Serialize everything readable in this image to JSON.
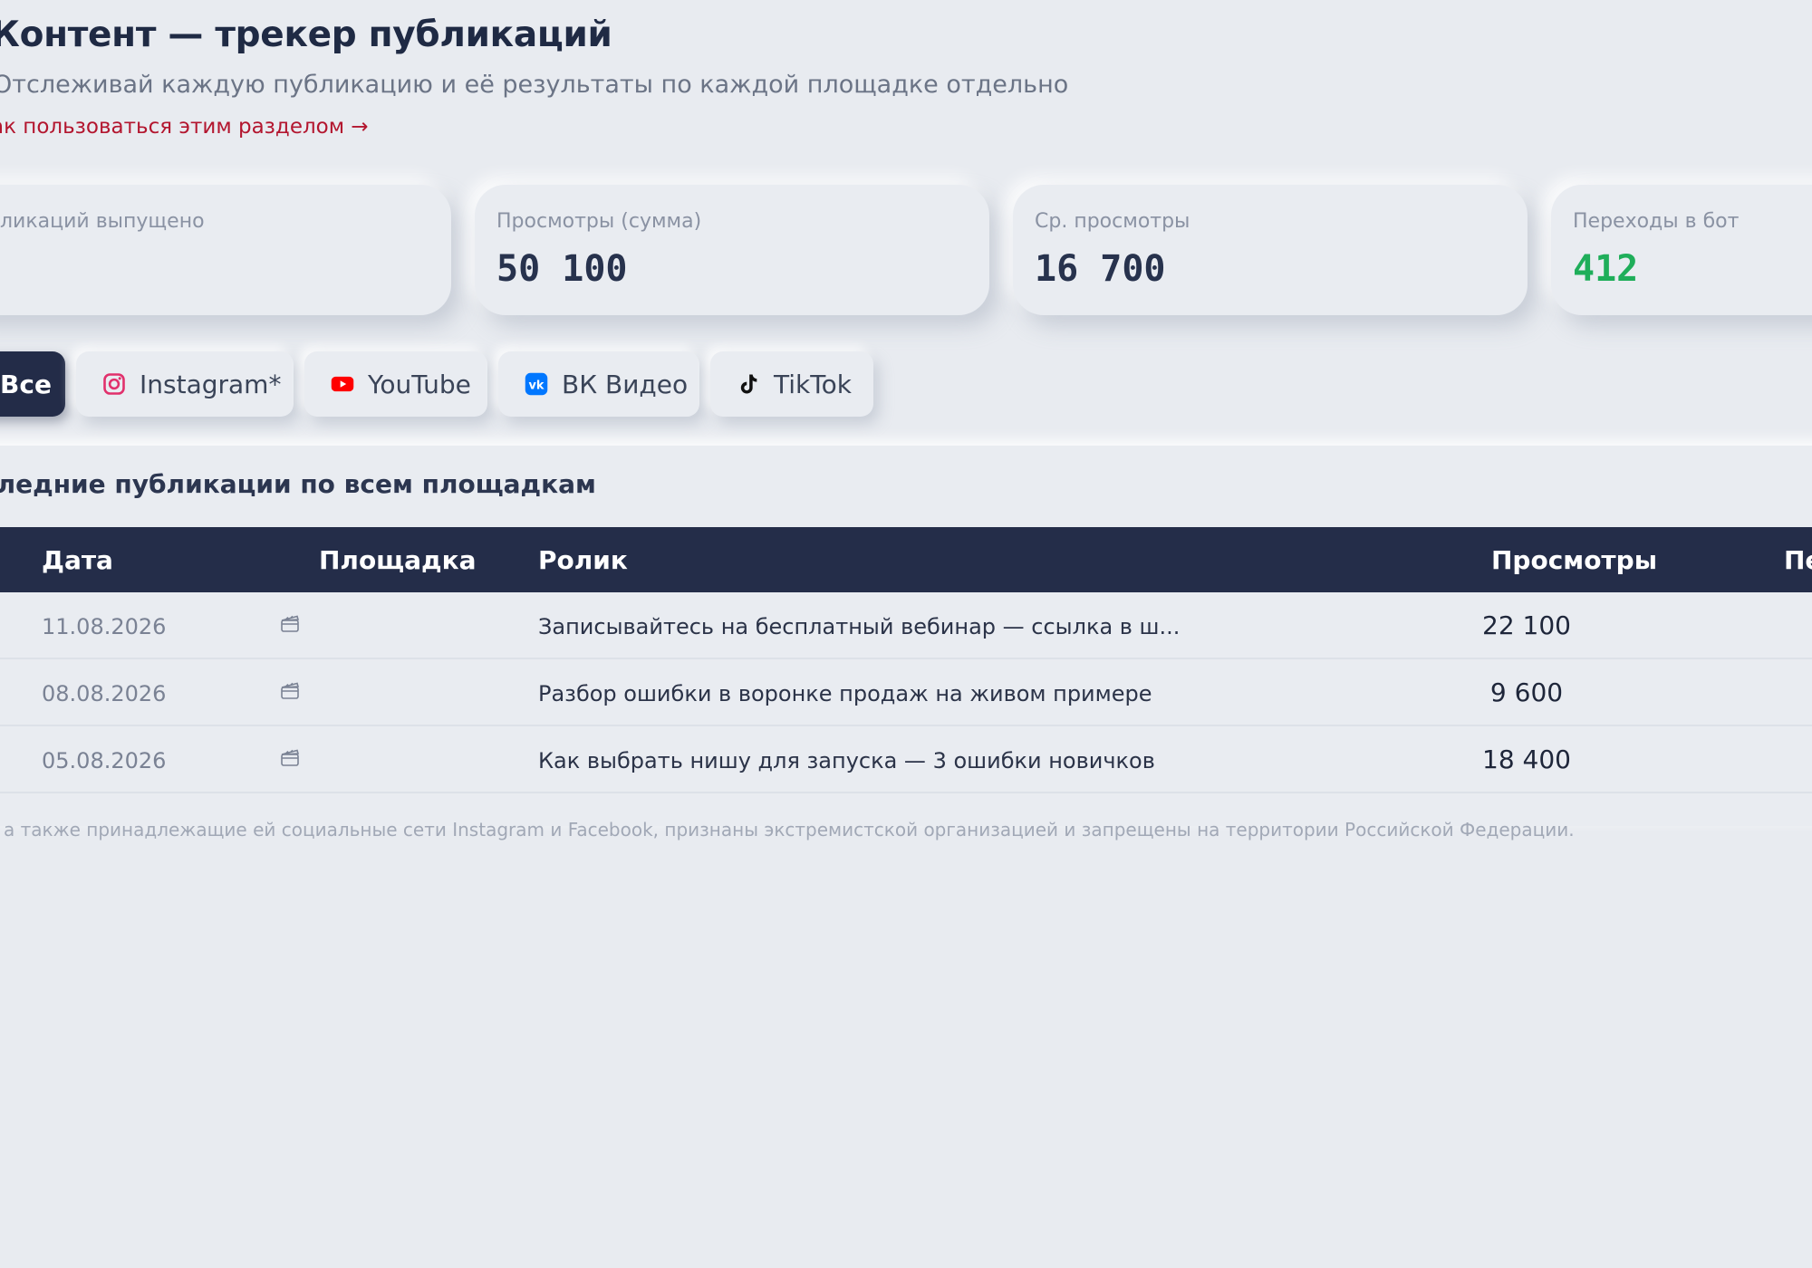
{
  "header": {
    "title": "Контент — трекер публикаций",
    "subtitle": "Отслеживай каждую публикацию и её результаты по каждой площадке отдельно",
    "help_link": "ак пользоваться этим разделом →"
  },
  "stats": [
    {
      "label": "ликаций выпущено",
      "value": ""
    },
    {
      "label": "Просмотры (сумма)",
      "value": "50 100"
    },
    {
      "label": "Ср. просмотры",
      "value": "16 700"
    },
    {
      "label": "Переходы в бот",
      "value": "412",
      "color": "#1fae5a"
    }
  ],
  "tabs": [
    {
      "label": "Все",
      "active": true
    },
    {
      "label": "Instagram*",
      "icon": "instagram-icon",
      "color": "#e1306c"
    },
    {
      "label": "YouTube",
      "icon": "youtube-icon",
      "color": "#ff0000"
    },
    {
      "label": "ВК Видео",
      "icon": "vk-icon",
      "color": "#0077ff"
    },
    {
      "label": "TikTok",
      "icon": "tiktok-icon",
      "color": "#111111"
    }
  ],
  "section": {
    "heading": "следние публикации по всем площадкам"
  },
  "table": {
    "columns": [
      "Дата",
      "Площадка",
      "Ролик",
      "Просмотры",
      "Пе"
    ],
    "rows": [
      {
        "date": "11.08.2026",
        "platform_icon": "clapperboard-icon",
        "title": "Записывайтесь на бесплатный вебинар — ссылка в ш...",
        "views": "22 100"
      },
      {
        "date": "08.08.2026",
        "platform_icon": "clapperboard-icon",
        "title": "Разбор ошибки в воронке продаж на живом примере",
        "views": "9 600"
      },
      {
        "date": "05.08.2026",
        "platform_icon": "clapperboard-icon",
        "title": "Как выбрать нишу для запуска — 3 ошибки новичков",
        "views": "18 400"
      }
    ]
  },
  "footnote": "а также принадлежащие ей социальные сети Instagram и Facebook, признаны экстремистской организацией и запрещены на территории Российской Федерации.",
  "colors": {
    "accent": "#b3162f",
    "dark": "#242d49",
    "positive": "#1fae5a"
  }
}
